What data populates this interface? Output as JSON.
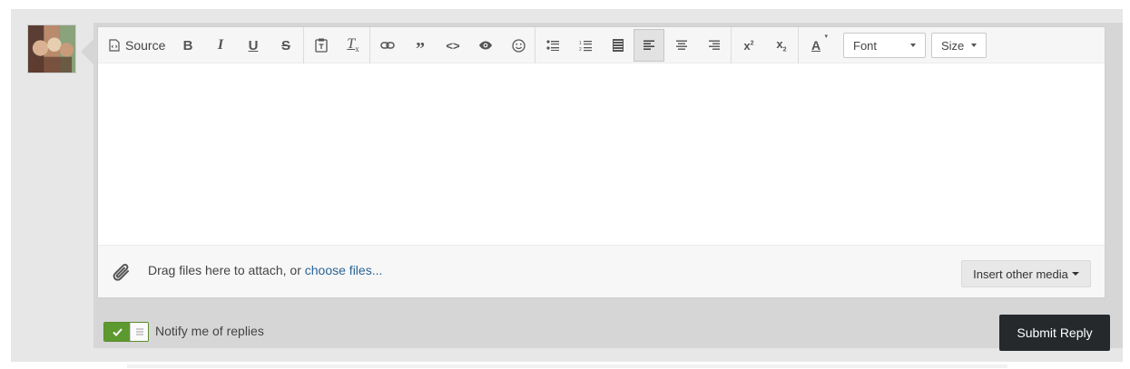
{
  "toolbar": {
    "source_label": "Source",
    "font_label": "Font",
    "size_label": "Size",
    "icons": [
      "source-icon",
      "bold-icon",
      "italic-icon",
      "underline-icon",
      "strikethrough-icon",
      "paste-text-icon",
      "remove-format-icon",
      "link-icon",
      "quote-icon",
      "code-icon",
      "preview-icon",
      "emoji-icon",
      "bulleted-list-icon",
      "numbered-list-icon",
      "justify-icon",
      "align-left-icon",
      "align-center-icon",
      "align-right-icon",
      "superscript-icon",
      "subscript-icon",
      "text-color-icon"
    ],
    "active_alignment": "left"
  },
  "attach": {
    "text": "Drag files here to attach, or",
    "link": "choose files...",
    "insert_media_label": "Insert other media"
  },
  "notify": {
    "label": "Notify me of replies",
    "enabled": true
  },
  "submit_label": "Submit Reply",
  "colors": {
    "toggle_on": "#5c9a2f",
    "submit_bg": "#25292c",
    "link": "#2a6496"
  }
}
